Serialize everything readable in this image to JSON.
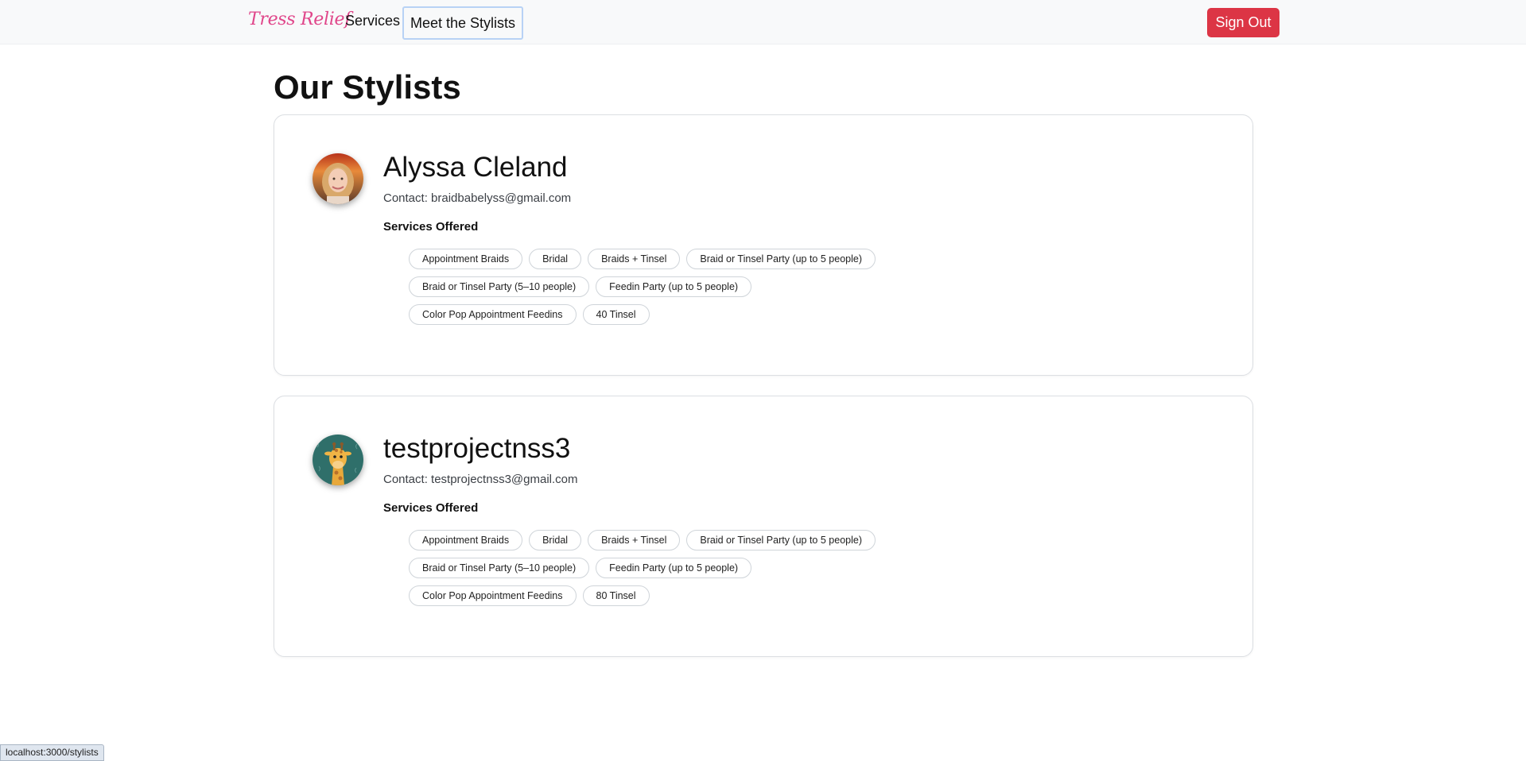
{
  "navbar": {
    "brand": "Tress Relief",
    "links": [
      "Services",
      "Meet the Stylists"
    ],
    "signout_label": "Sign Out",
    "signout_color": "#dc3545",
    "brand_color": "#e0468a"
  },
  "page": {
    "title": "Our Stylists"
  },
  "stylists": [
    {
      "name": "Alyssa Cleland",
      "contact": "Contact: braidbabelyss@gmail.com",
      "services_heading": "Services Offered",
      "avatar_icon": "portrait-photo",
      "services": [
        "Appointment Braids",
        "Bridal",
        "Braids + Tinsel",
        "Braid or Tinsel Party (up to 5 people)",
        "Braid or Tinsel Party (5–10 people)",
        "Feedin Party (up to 5 people)",
        "Color Pop Appointment Feedins",
        "40 Tinsel"
      ]
    },
    {
      "name": "testprojectnss3",
      "contact": "Contact: testprojectnss3@gmail.com",
      "services_heading": "Services Offered",
      "avatar_icon": "giraffe-illustration",
      "services": [
        "Appointment Braids",
        "Bridal",
        "Braids + Tinsel",
        "Braid or Tinsel Party (up to 5 people)",
        "Braid or Tinsel Party (5–10 people)",
        "Feedin Party (up to 5 people)",
        "Color Pop Appointment Feedins",
        "80 Tinsel"
      ]
    }
  ],
  "status_bar": {
    "url": "localhost:3000/stylists"
  }
}
